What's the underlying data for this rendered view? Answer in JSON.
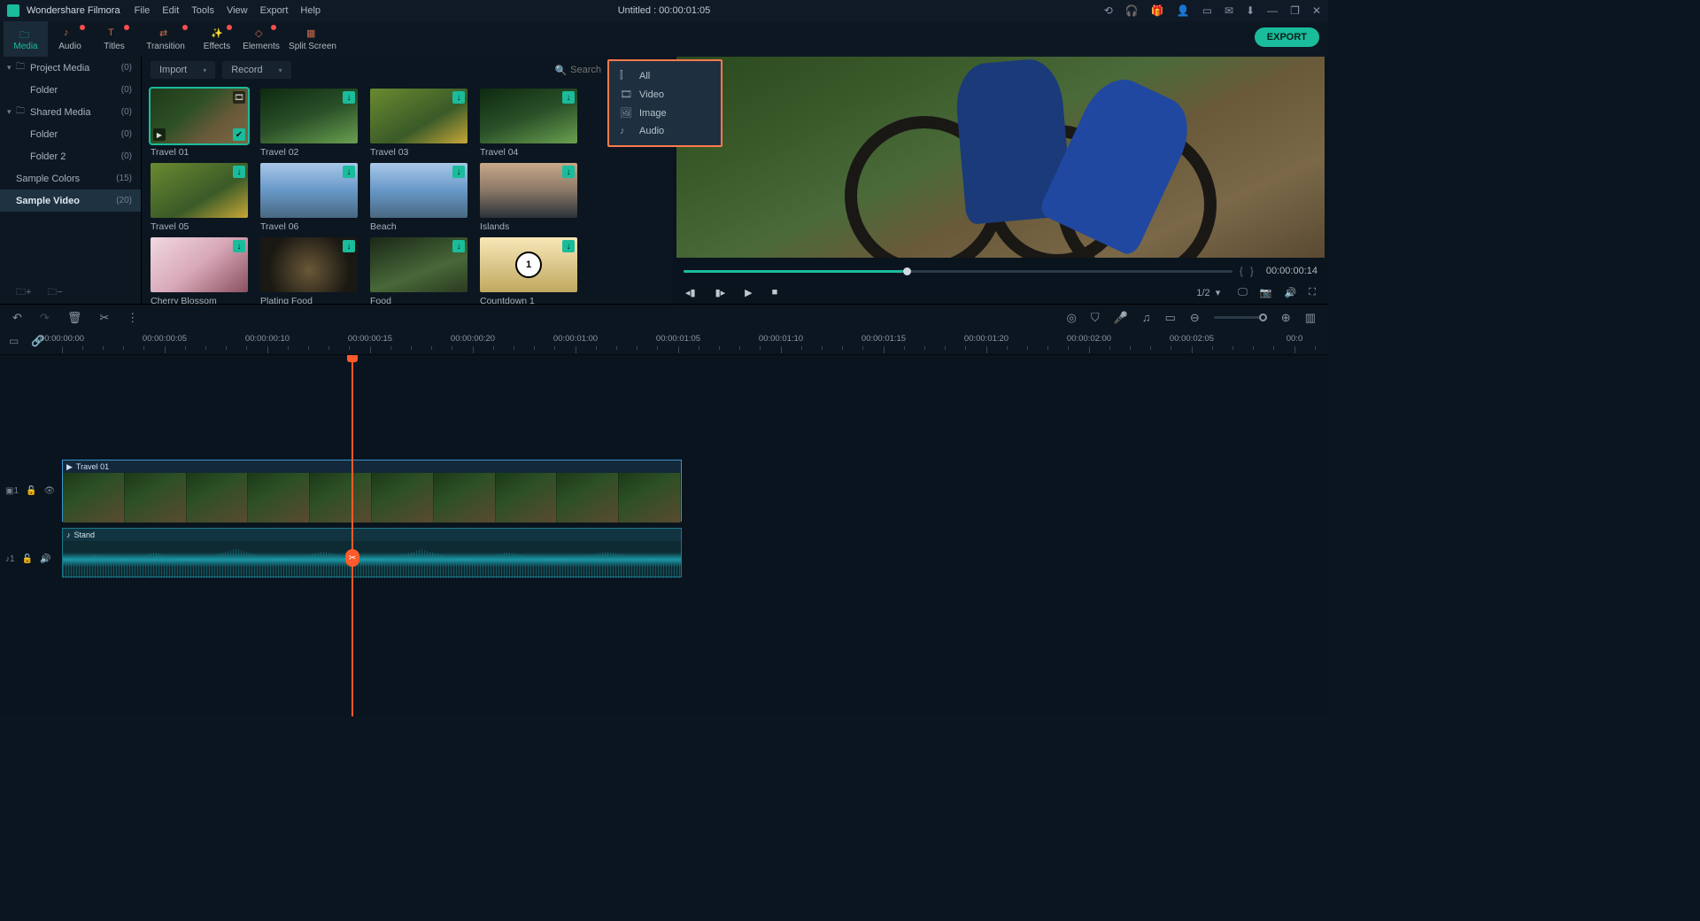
{
  "app": {
    "name": "Wondershare Filmora",
    "title": "Untitled : 00:00:01:05"
  },
  "menu": [
    "File",
    "Edit",
    "Tools",
    "View",
    "Export",
    "Help"
  ],
  "win_icons": [
    "⟲",
    "🎧",
    "🎁",
    "👤",
    "▭",
    "✉",
    "⬇",
    "—",
    "❐",
    "✕"
  ],
  "tabs": [
    {
      "label": "Media",
      "active": true,
      "dot": false
    },
    {
      "label": "Audio",
      "active": false,
      "dot": true
    },
    {
      "label": "Titles",
      "active": false,
      "dot": true
    },
    {
      "label": "Transition",
      "active": false,
      "dot": true
    },
    {
      "label": "Effects",
      "active": false,
      "dot": true
    },
    {
      "label": "Elements",
      "active": false,
      "dot": true
    },
    {
      "label": "Split Screen",
      "active": false,
      "dot": false
    }
  ],
  "export_label": "EXPORT",
  "sidebar": [
    {
      "label": "Project Media",
      "count": "(0)",
      "chev": true,
      "fold": true,
      "indent": false,
      "active": false
    },
    {
      "label": "Folder",
      "count": "(0)",
      "chev": false,
      "fold": false,
      "indent": true,
      "active": false
    },
    {
      "label": "Shared Media",
      "count": "(0)",
      "chev": true,
      "fold": true,
      "indent": false,
      "active": false
    },
    {
      "label": "Folder",
      "count": "(0)",
      "chev": false,
      "fold": false,
      "indent": true,
      "active": false
    },
    {
      "label": "Folder 2",
      "count": "(0)",
      "chev": false,
      "fold": false,
      "indent": true,
      "active": false
    },
    {
      "label": "Sample Colors",
      "count": "(15)",
      "chev": false,
      "fold": false,
      "indent": false,
      "active": false
    },
    {
      "label": "Sample Video",
      "count": "(20)",
      "chev": false,
      "fold": false,
      "indent": false,
      "active": true
    }
  ],
  "browser": {
    "import": "Import",
    "record": "Record",
    "search_placeholder": "Search"
  },
  "filter_menu": [
    "All",
    "Video",
    "Image",
    "Audio"
  ],
  "thumbs": [
    [
      {
        "l": "Travel 01",
        "c": "bike",
        "sel": true,
        "b": "film"
      },
      {
        "l": "Travel 02",
        "c": "forest",
        "b": "dl"
      },
      {
        "l": "Travel 03",
        "c": "yellow",
        "b": "dl"
      },
      {
        "l": "Travel 04",
        "c": "forest",
        "b": "dl"
      }
    ],
    [
      {
        "l": "Travel 05",
        "c": "yellow",
        "b": "dl"
      },
      {
        "l": "Travel 06",
        "c": "sea",
        "b": "dl"
      },
      {
        "l": "Beach",
        "c": "sea",
        "b": "dl"
      },
      {
        "l": "Islands",
        "c": "dusk",
        "b": "dl"
      }
    ],
    [
      {
        "l": "Cherry Blossom",
        "c": "blossom",
        "b": "dl"
      },
      {
        "l": "Plating Food",
        "c": "food1",
        "b": "dl"
      },
      {
        "l": "Food",
        "c": "food2",
        "b": "dl"
      },
      {
        "l": "Countdown 1",
        "c": "cd1",
        "b": "dl"
      }
    ],
    [
      {
        "l": "",
        "c": "cd2",
        "b": "dl"
      },
      {
        "l": "",
        "c": "cd3",
        "b": "dl"
      },
      {
        "l": "",
        "c": "cd4",
        "b": "dl"
      },
      {
        "l": "",
        "c": "cd5",
        "b": "dl"
      }
    ]
  ],
  "preview": {
    "timecode": "00:00:00:14",
    "ratio": "1/2"
  },
  "ruler": [
    "00:00:00:00",
    "00:00:00:05",
    "00:00:00:10",
    "00:00:00:15",
    "00:00:00:20",
    "00:00:01:00",
    "00:00:01:05",
    "00:00:01:10",
    "00:00:01:15",
    "00:00:01:20",
    "00:00:02:00",
    "00:00:02:05",
    "00:0"
  ],
  "track_v_head": "▣1",
  "track_a_head": "♪1",
  "clips": {
    "video": "Travel 01",
    "audio": "Stand"
  }
}
